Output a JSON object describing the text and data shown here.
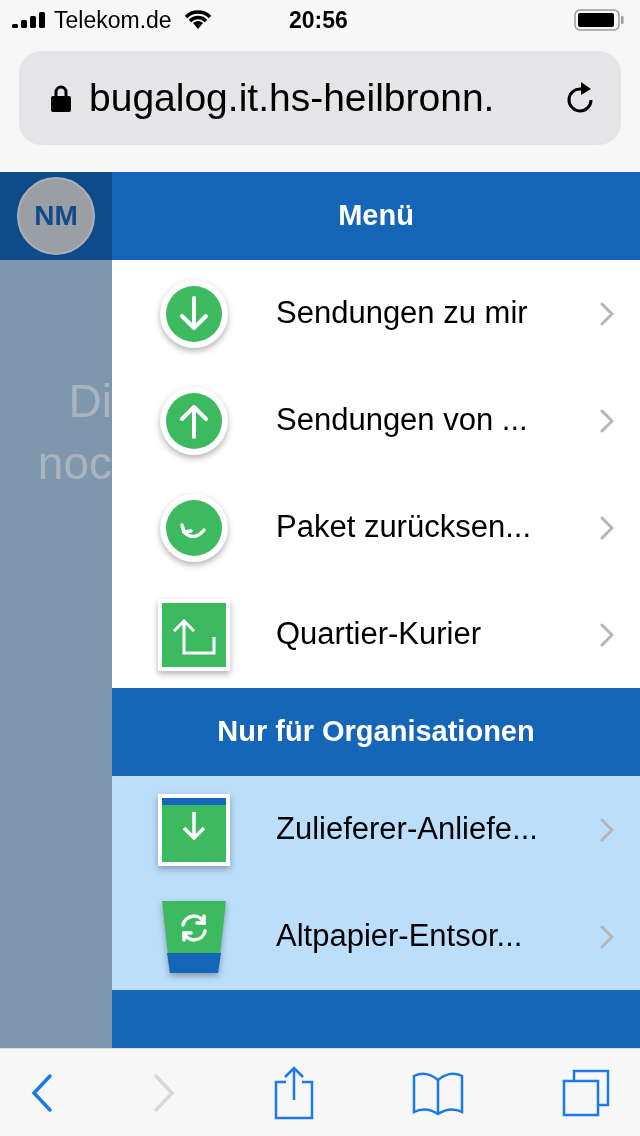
{
  "status_bar": {
    "carrier": "Telekom.de",
    "time": "20:56"
  },
  "address_bar": {
    "url": "bugalog.it.hs-heilbronn."
  },
  "backdrop": {
    "avatar": "NM",
    "lines": [
      "Di",
      "noc"
    ]
  },
  "menu": {
    "title": "Menü",
    "items": [
      {
        "kind": "circle-down",
        "label": "Sendungen zu mir"
      },
      {
        "kind": "circle-up",
        "label": "Sendungen von ..."
      },
      {
        "kind": "circle-return",
        "label": "Paket zurücksen..."
      },
      {
        "kind": "square-upload",
        "label": "Quartier-Kurier"
      }
    ]
  },
  "organisations": {
    "title": "Nur für Organisationen",
    "items": [
      {
        "kind": "square-download",
        "label": "Zulieferer-Anliefe..."
      },
      {
        "kind": "bin-recycle",
        "label": "Altpapier-Entsor..."
      }
    ]
  },
  "toolbar": {
    "forward_disabled": true
  }
}
